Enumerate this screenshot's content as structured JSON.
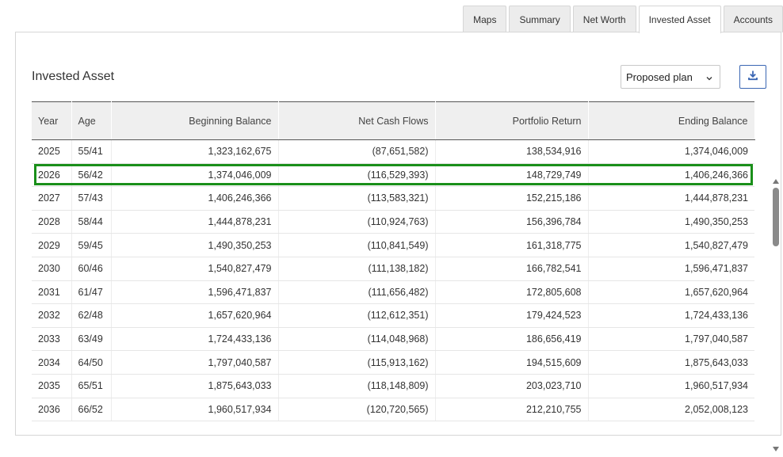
{
  "tabs": [
    {
      "label": "Maps",
      "active": false
    },
    {
      "label": "Summary",
      "active": false
    },
    {
      "label": "Net Worth",
      "active": false
    },
    {
      "label": "Invested Asset",
      "active": true
    },
    {
      "label": "Accounts",
      "active": false
    }
  ],
  "panel": {
    "title": "Invested Asset",
    "plan_select": {
      "value": "Proposed plan"
    },
    "download_icon": "download-icon"
  },
  "table": {
    "columns": [
      "Year",
      "Age",
      "Beginning Balance",
      "Net Cash Flows",
      "Portfolio Return",
      "Ending Balance"
    ],
    "rows": [
      [
        "2025",
        "55/41",
        "1,323,162,675",
        "(87,651,582)",
        "138,534,916",
        "1,374,046,009"
      ],
      [
        "2026",
        "56/42",
        "1,374,046,009",
        "(116,529,393)",
        "148,729,749",
        "1,406,246,366"
      ],
      [
        "2027",
        "57/43",
        "1,406,246,366",
        "(113,583,321)",
        "152,215,186",
        "1,444,878,231"
      ],
      [
        "2028",
        "58/44",
        "1,444,878,231",
        "(110,924,763)",
        "156,396,784",
        "1,490,350,253"
      ],
      [
        "2029",
        "59/45",
        "1,490,350,253",
        "(110,841,549)",
        "161,318,775",
        "1,540,827,479"
      ],
      [
        "2030",
        "60/46",
        "1,540,827,479",
        "(111,138,182)",
        "166,782,541",
        "1,596,471,837"
      ],
      [
        "2031",
        "61/47",
        "1,596,471,837",
        "(111,656,482)",
        "172,805,608",
        "1,657,620,964"
      ],
      [
        "2032",
        "62/48",
        "1,657,620,964",
        "(112,612,351)",
        "179,424,523",
        "1,724,433,136"
      ],
      [
        "2033",
        "63/49",
        "1,724,433,136",
        "(114,048,968)",
        "186,656,419",
        "1,797,040,587"
      ],
      [
        "2034",
        "64/50",
        "1,797,040,587",
        "(115,913,162)",
        "194,515,609",
        "1,875,643,033"
      ],
      [
        "2035",
        "65/51",
        "1,875,643,033",
        "(118,148,809)",
        "203,023,710",
        "1,960,517,934"
      ],
      [
        "2036",
        "66/52",
        "1,960,517,934",
        "(120,720,565)",
        "212,210,755",
        "2,052,008,123"
      ]
    ],
    "highlighted_row": 1,
    "highlight_color": "#1a8f1a"
  },
  "colors": {
    "accent": "#3a66b3",
    "header_bg": "#efefef",
    "tab_bg": "#ececec"
  }
}
